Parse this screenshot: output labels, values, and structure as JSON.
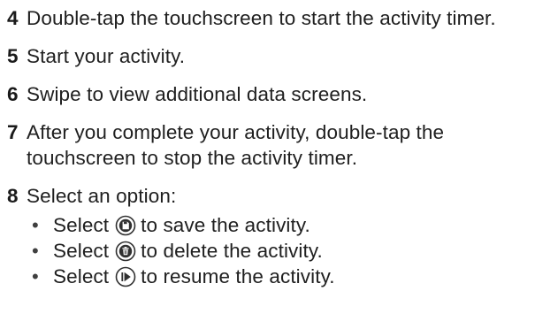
{
  "steps": [
    {
      "number": "4",
      "text": "Double-tap the touchscreen to start the activity timer."
    },
    {
      "number": "5",
      "text": "Start your activity."
    },
    {
      "number": "6",
      "text": "Swipe to view additional data screens."
    },
    {
      "number": "7",
      "text": "After you complete your activity, double-tap the touchscreen to stop the activity timer."
    },
    {
      "number": "8",
      "text": "Select an option:"
    }
  ],
  "options": [
    {
      "bullet": "•",
      "prefix": "Select",
      "icon": "save-icon",
      "suffix": "to save the activity."
    },
    {
      "bullet": "•",
      "prefix": "Select",
      "icon": "delete-icon",
      "suffix": "to delete the activity."
    },
    {
      "bullet": "•",
      "prefix": "Select",
      "icon": "resume-icon",
      "suffix": "to resume the activity."
    }
  ],
  "colors": {
    "text": "#202020",
    "icon_stroke": "#303030"
  }
}
